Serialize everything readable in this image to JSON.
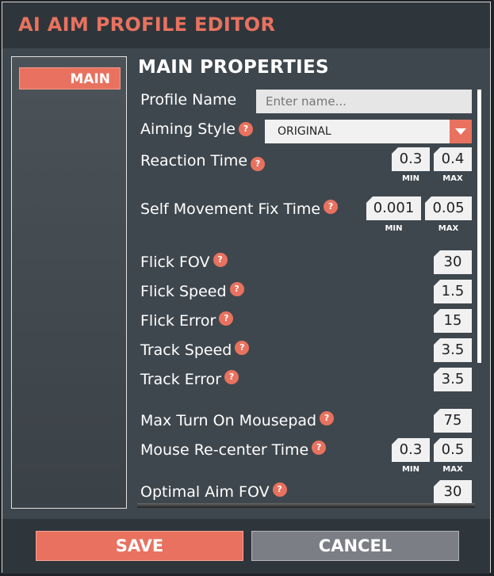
{
  "window": {
    "title": "AI AIM PROFILE EDITOR"
  },
  "sidebar": {
    "tabs": [
      {
        "label": "MAIN"
      }
    ]
  },
  "main": {
    "section_title": "MAIN PROPERTIES",
    "profile_name": {
      "label": "Profile Name",
      "placeholder": "Enter name...",
      "value": ""
    },
    "aiming_style": {
      "label": "Aiming Style",
      "value": "ORIGINAL"
    },
    "reaction_time": {
      "label": "Reaction Time",
      "min": "0.3",
      "max": "0.4"
    },
    "self_movement_fix_time": {
      "label": "Self Movement Fix Time",
      "min": "0.001",
      "max": "0.05"
    },
    "flick_fov": {
      "label": "Flick FOV",
      "value": "30"
    },
    "flick_speed": {
      "label": "Flick Speed",
      "value": "1.5"
    },
    "flick_error": {
      "label": "Flick Error",
      "value": "15"
    },
    "track_speed": {
      "label": "Track Speed",
      "value": "3.5"
    },
    "track_error": {
      "label": "Track Error",
      "value": "3.5"
    },
    "max_turn_on_mousepad": {
      "label": "Max Turn On Mousepad",
      "value": "75"
    },
    "mouse_recenter_time": {
      "label": "Mouse Re-center Time",
      "min": "0.3",
      "max": "0.5"
    },
    "optimal_aim_fov": {
      "label": "Optimal Aim FOV",
      "value": "30"
    },
    "min_label": "MIN",
    "max_label": "MAX",
    "help_glyph": "?"
  },
  "footer": {
    "save_label": "SAVE",
    "cancel_label": "CANCEL"
  },
  "colors": {
    "accent": "#e8725f",
    "panel": "#3f474e",
    "bar": "#2e353b",
    "cancel": "#7c7e86"
  }
}
